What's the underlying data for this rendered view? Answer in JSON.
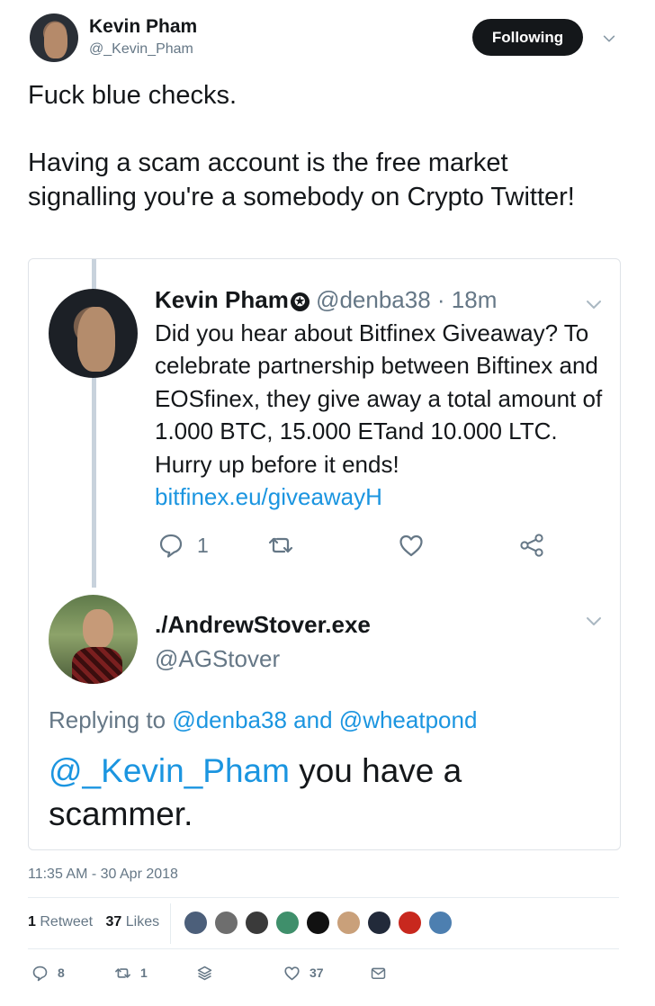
{
  "author": {
    "name": "Kevin Pham",
    "handle": "@_Kevin_Pham",
    "follow_label": "Following"
  },
  "tweet": {
    "text": "Fuck blue checks.\n\nHaving a scam account is the free market signalling you're a somebody on Crypto Twitter!"
  },
  "quoted": {
    "name": "Kevin Pham",
    "handle": "@denba38",
    "time": "· 18m",
    "body": "Did you hear about Bitfinex Giveaway? To celebrate partnership between Biftinex and EOSfinex, they give away a total amount of 1.000 BTC, 15.000 ETand 10.000 LTC. Hurry up before it ends! ",
    "link": "bitfinex.eu/giveawayH",
    "reply_count": "1"
  },
  "reply": {
    "name": "./AndrewStover.exe",
    "handle": "@AGStover",
    "replying_prefix": "Replying to",
    "replying_to_1": "@denba38",
    "replying_and": "and",
    "replying_to_2": "@wheatpond",
    "mention": "@_Kevin_Pham",
    "body_rest": "you have a scammer."
  },
  "footer": {
    "timestamp": "11:35 AM - 30 Apr 2018",
    "retweets": "1",
    "retweets_label": "Retweet",
    "likes": "37",
    "likes_label": "Likes",
    "reply_count": "8",
    "retweet_count": "1",
    "like_count": "37"
  },
  "colors": {
    "link": "#1b95e0",
    "muted": "#657786",
    "text": "#14171a",
    "liker_avatars": [
      "#4c5f7a",
      "#6e6e6e",
      "#3a3a3a",
      "#3f8f6b",
      "#111111",
      "#c9a07a",
      "#222a3a",
      "#c8281e",
      "#4d7fb0"
    ]
  },
  "icons": [
    "chevron-down-icon",
    "reply-icon",
    "retweet-icon",
    "heart-icon",
    "share-icon",
    "stack-icon",
    "mail-icon",
    "verified-badge-icon"
  ]
}
